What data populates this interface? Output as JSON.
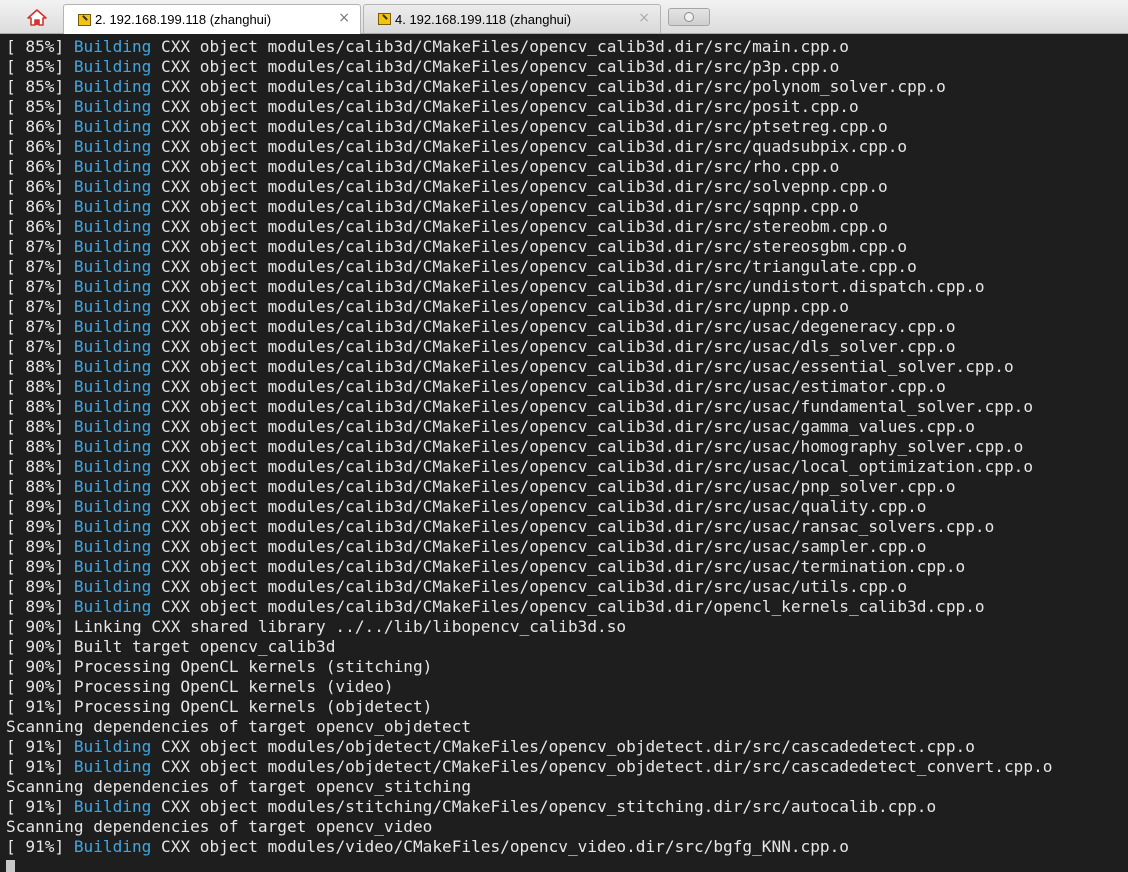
{
  "tabs": [
    {
      "label": "2. 192.168.199.118 (zhanghui)",
      "active": true,
      "close": "×"
    },
    {
      "label": "4. 192.168.199.118 (zhanghui)",
      "active": false,
      "close": "×"
    }
  ],
  "icons": {
    "home": "home-icon",
    "tab": "terminal-session-icon",
    "new_tab": "new-tab-icon"
  },
  "colors": {
    "keyword": "#3fa8e4",
    "text": "#e6e6e6",
    "background": "#1e1e1e"
  },
  "terminal": {
    "lines": [
      {
        "pre": "[ 85%] ",
        "kw": "Building",
        "post": " CXX object modules/calib3d/CMakeFiles/opencv_calib3d.dir/src/main.cpp.o"
      },
      {
        "pre": "[ 85%] ",
        "kw": "Building",
        "post": " CXX object modules/calib3d/CMakeFiles/opencv_calib3d.dir/src/p3p.cpp.o"
      },
      {
        "pre": "[ 85%] ",
        "kw": "Building",
        "post": " CXX object modules/calib3d/CMakeFiles/opencv_calib3d.dir/src/polynom_solver.cpp.o"
      },
      {
        "pre": "[ 85%] ",
        "kw": "Building",
        "post": " CXX object modules/calib3d/CMakeFiles/opencv_calib3d.dir/src/posit.cpp.o"
      },
      {
        "pre": "[ 86%] ",
        "kw": "Building",
        "post": " CXX object modules/calib3d/CMakeFiles/opencv_calib3d.dir/src/ptsetreg.cpp.o"
      },
      {
        "pre": "[ 86%] ",
        "kw": "Building",
        "post": " CXX object modules/calib3d/CMakeFiles/opencv_calib3d.dir/src/quadsubpix.cpp.o"
      },
      {
        "pre": "[ 86%] ",
        "kw": "Building",
        "post": " CXX object modules/calib3d/CMakeFiles/opencv_calib3d.dir/src/rho.cpp.o"
      },
      {
        "pre": "[ 86%] ",
        "kw": "Building",
        "post": " CXX object modules/calib3d/CMakeFiles/opencv_calib3d.dir/src/solvepnp.cpp.o"
      },
      {
        "pre": "[ 86%] ",
        "kw": "Building",
        "post": " CXX object modules/calib3d/CMakeFiles/opencv_calib3d.dir/src/sqpnp.cpp.o"
      },
      {
        "pre": "[ 86%] ",
        "kw": "Building",
        "post": " CXX object modules/calib3d/CMakeFiles/opencv_calib3d.dir/src/stereobm.cpp.o"
      },
      {
        "pre": "[ 87%] ",
        "kw": "Building",
        "post": " CXX object modules/calib3d/CMakeFiles/opencv_calib3d.dir/src/stereosgbm.cpp.o"
      },
      {
        "pre": "[ 87%] ",
        "kw": "Building",
        "post": " CXX object modules/calib3d/CMakeFiles/opencv_calib3d.dir/src/triangulate.cpp.o"
      },
      {
        "pre": "[ 87%] ",
        "kw": "Building",
        "post": " CXX object modules/calib3d/CMakeFiles/opencv_calib3d.dir/src/undistort.dispatch.cpp.o"
      },
      {
        "pre": "[ 87%] ",
        "kw": "Building",
        "post": " CXX object modules/calib3d/CMakeFiles/opencv_calib3d.dir/src/upnp.cpp.o"
      },
      {
        "pre": "[ 87%] ",
        "kw": "Building",
        "post": " CXX object modules/calib3d/CMakeFiles/opencv_calib3d.dir/src/usac/degeneracy.cpp.o"
      },
      {
        "pre": "[ 87%] ",
        "kw": "Building",
        "post": " CXX object modules/calib3d/CMakeFiles/opencv_calib3d.dir/src/usac/dls_solver.cpp.o"
      },
      {
        "pre": "[ 88%] ",
        "kw": "Building",
        "post": " CXX object modules/calib3d/CMakeFiles/opencv_calib3d.dir/src/usac/essential_solver.cpp.o"
      },
      {
        "pre": "[ 88%] ",
        "kw": "Building",
        "post": " CXX object modules/calib3d/CMakeFiles/opencv_calib3d.dir/src/usac/estimator.cpp.o"
      },
      {
        "pre": "[ 88%] ",
        "kw": "Building",
        "post": " CXX object modules/calib3d/CMakeFiles/opencv_calib3d.dir/src/usac/fundamental_solver.cpp.o"
      },
      {
        "pre": "[ 88%] ",
        "kw": "Building",
        "post": " CXX object modules/calib3d/CMakeFiles/opencv_calib3d.dir/src/usac/gamma_values.cpp.o"
      },
      {
        "pre": "[ 88%] ",
        "kw": "Building",
        "post": " CXX object modules/calib3d/CMakeFiles/opencv_calib3d.dir/src/usac/homography_solver.cpp.o"
      },
      {
        "pre": "[ 88%] ",
        "kw": "Building",
        "post": " CXX object modules/calib3d/CMakeFiles/opencv_calib3d.dir/src/usac/local_optimization.cpp.o"
      },
      {
        "pre": "[ 88%] ",
        "kw": "Building",
        "post": " CXX object modules/calib3d/CMakeFiles/opencv_calib3d.dir/src/usac/pnp_solver.cpp.o"
      },
      {
        "pre": "[ 89%] ",
        "kw": "Building",
        "post": " CXX object modules/calib3d/CMakeFiles/opencv_calib3d.dir/src/usac/quality.cpp.o"
      },
      {
        "pre": "[ 89%] ",
        "kw": "Building",
        "post": " CXX object modules/calib3d/CMakeFiles/opencv_calib3d.dir/src/usac/ransac_solvers.cpp.o"
      },
      {
        "pre": "[ 89%] ",
        "kw": "Building",
        "post": " CXX object modules/calib3d/CMakeFiles/opencv_calib3d.dir/src/usac/sampler.cpp.o"
      },
      {
        "pre": "[ 89%] ",
        "kw": "Building",
        "post": " CXX object modules/calib3d/CMakeFiles/opencv_calib3d.dir/src/usac/termination.cpp.o"
      },
      {
        "pre": "[ 89%] ",
        "kw": "Building",
        "post": " CXX object modules/calib3d/CMakeFiles/opencv_calib3d.dir/src/usac/utils.cpp.o"
      },
      {
        "pre": "[ 89%] ",
        "kw": "Building",
        "post": " CXX object modules/calib3d/CMakeFiles/opencv_calib3d.dir/opencl_kernels_calib3d.cpp.o"
      },
      {
        "pre": "[ 90%] Linking CXX shared library ../../lib/libopencv_calib3d.so",
        "kw": "",
        "post": ""
      },
      {
        "pre": "[ 90%] Built target opencv_calib3d",
        "kw": "",
        "post": ""
      },
      {
        "pre": "[ 90%] Processing OpenCL kernels (stitching)",
        "kw": "",
        "post": ""
      },
      {
        "pre": "[ 90%] Processing OpenCL kernels (video)",
        "kw": "",
        "post": ""
      },
      {
        "pre": "[ 91%] Processing OpenCL kernels (objdetect)",
        "kw": "",
        "post": ""
      },
      {
        "pre": "Scanning dependencies of target opencv_objdetect",
        "kw": "",
        "post": ""
      },
      {
        "pre": "[ 91%] ",
        "kw": "Building",
        "post": " CXX object modules/objdetect/CMakeFiles/opencv_objdetect.dir/src/cascadedetect.cpp.o"
      },
      {
        "pre": "[ 91%] ",
        "kw": "Building",
        "post": " CXX object modules/objdetect/CMakeFiles/opencv_objdetect.dir/src/cascadedetect_convert.cpp.o"
      },
      {
        "pre": "Scanning dependencies of target opencv_stitching",
        "kw": "",
        "post": ""
      },
      {
        "pre": "[ 91%] ",
        "kw": "Building",
        "post": " CXX object modules/stitching/CMakeFiles/opencv_stitching.dir/src/autocalib.cpp.o"
      },
      {
        "pre": "Scanning dependencies of target opencv_video",
        "kw": "",
        "post": ""
      },
      {
        "pre": "[ 91%] ",
        "kw": "Building",
        "post": " CXX object modules/video/CMakeFiles/opencv_video.dir/src/bgfg_KNN.cpp.o"
      }
    ]
  }
}
